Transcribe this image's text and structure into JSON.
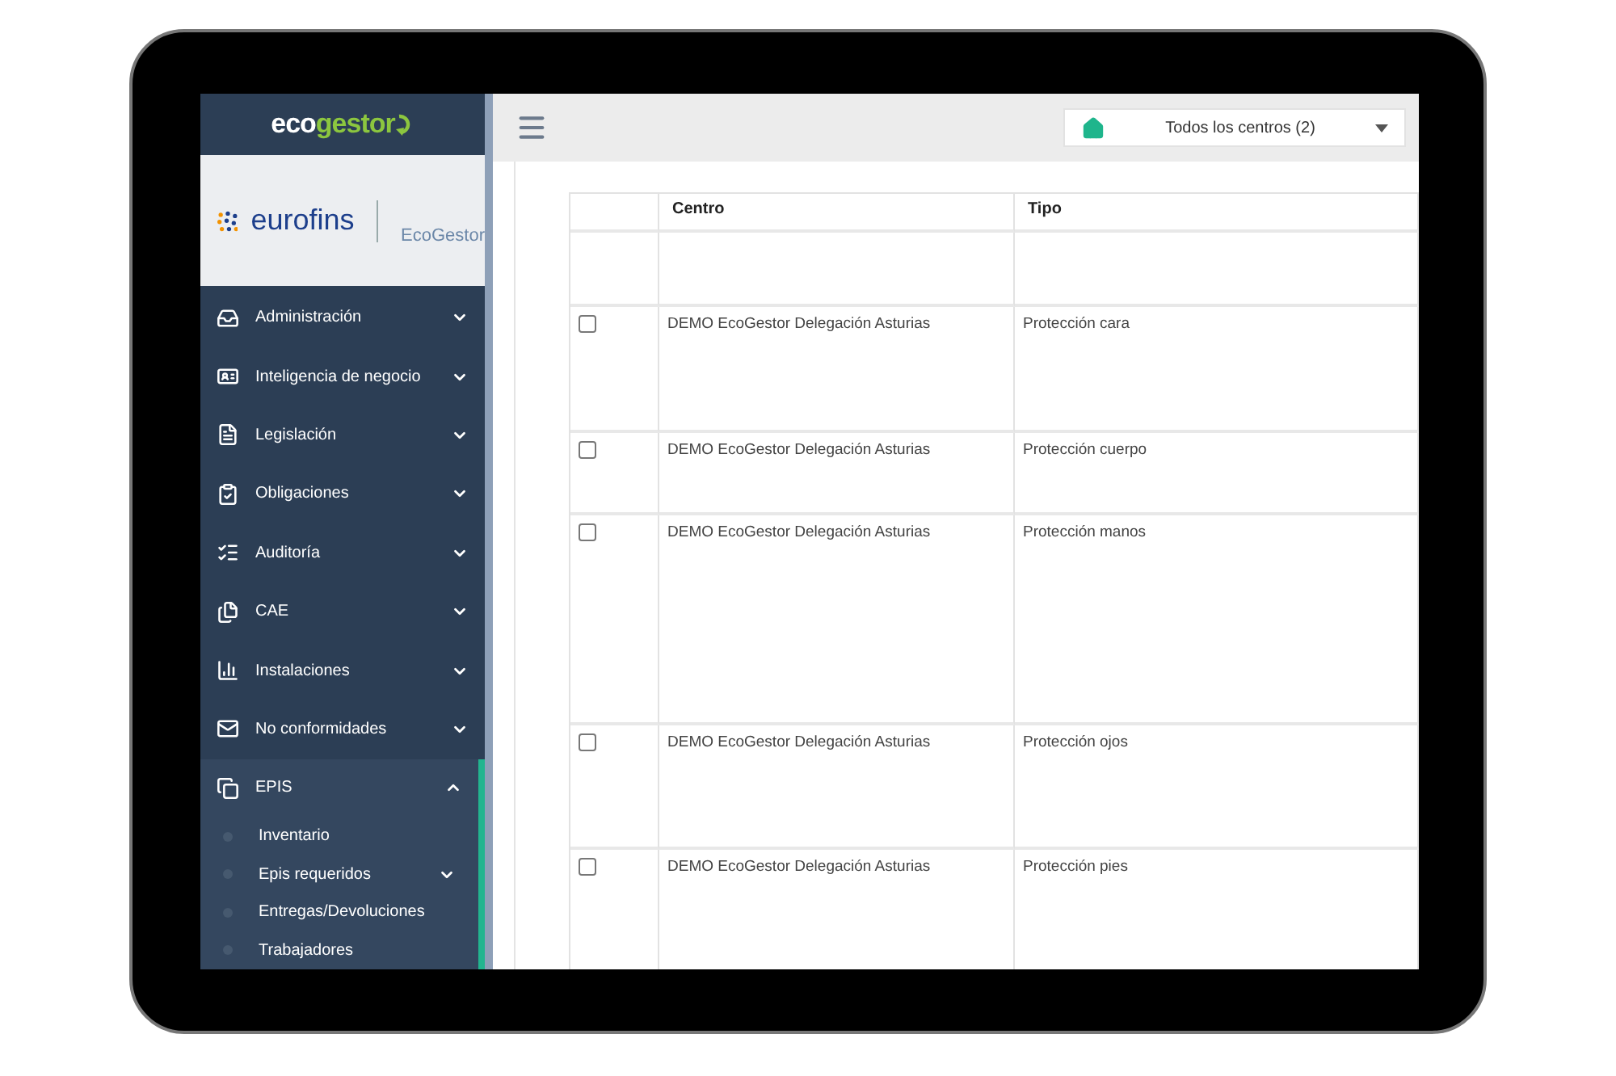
{
  "logo": {
    "part_1": "eco",
    "part_2": "gestor"
  },
  "brand": {
    "name": "eurofins",
    "product": "EcoGestor"
  },
  "menu": [
    {
      "label": "Administración",
      "expanded": false,
      "selected": false
    },
    {
      "label": "Inteligencia de negocio",
      "expanded": false,
      "selected": false
    },
    {
      "label": "Legislación",
      "expanded": false,
      "selected": false
    },
    {
      "label": "Obligaciones",
      "expanded": false,
      "selected": false
    },
    {
      "label": "Auditoría",
      "expanded": false,
      "selected": false
    },
    {
      "label": "CAE",
      "expanded": false,
      "selected": false
    },
    {
      "label": "Instalaciones",
      "expanded": false,
      "selected": false
    },
    {
      "label": "No conformidades",
      "expanded": false,
      "selected": false
    },
    {
      "label": "EPIS",
      "expanded": true,
      "selected": true,
      "children": [
        {
          "label": "Inventario",
          "expandable": false
        },
        {
          "label": "Epis requeridos",
          "expandable": true
        },
        {
          "label": "Entregas/Devoluciones",
          "expandable": false
        },
        {
          "label": "Trabajadores",
          "expandable": false
        }
      ]
    }
  ],
  "center_selector": {
    "value": "Todos los centros (2)"
  },
  "table": {
    "columns": [
      "Centro",
      "Tipo"
    ],
    "rows": [
      {
        "checked": false,
        "centro": "DEMO EcoGestor Delegación Asturias",
        "tipo": "Protección cara"
      },
      {
        "checked": false,
        "centro": "DEMO EcoGestor Delegación Asturias",
        "tipo": "Protección cuerpo"
      },
      {
        "checked": false,
        "centro": "DEMO EcoGestor Delegación Asturias",
        "tipo": "Protección manos"
      },
      {
        "checked": false,
        "centro": "DEMO EcoGestor Delegación Asturias",
        "tipo": "Protección ojos"
      },
      {
        "checked": false,
        "centro": "DEMO EcoGestor Delegación Asturias",
        "tipo": "Protección pies"
      }
    ]
  }
}
